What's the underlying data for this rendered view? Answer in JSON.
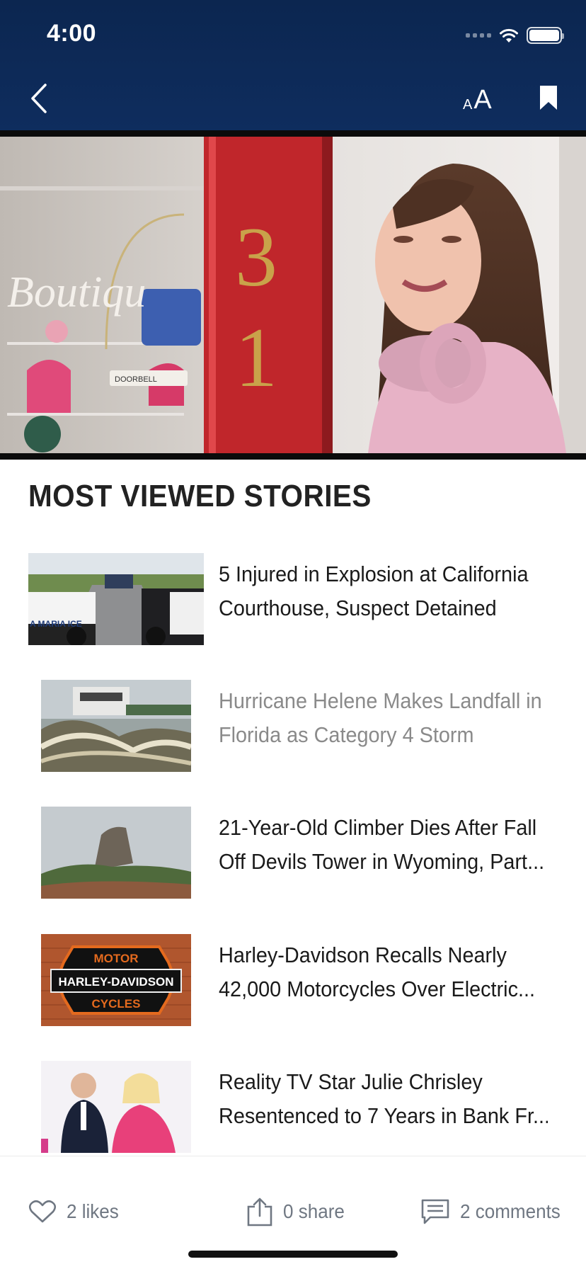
{
  "status_bar": {
    "time": "4:00"
  },
  "header": {
    "font_small": "A",
    "font_big": "A"
  },
  "hero": {
    "sign_text": "Boutiqu",
    "door_numbers": [
      "3",
      "1"
    ],
    "doorbell_label": "DOORBELL"
  },
  "section": {
    "title": "MOST VIEWED STORIES"
  },
  "stories": [
    {
      "line1": "5 Injured in Explosion at California",
      "line2": "Courthouse, Suspect Detained",
      "muted": false,
      "thumb_text": "A MARIA  ICE"
    },
    {
      "line1": "Hurricane Helene Makes Landfall in",
      "line2": "Florida as Category 4 Storm",
      "muted": true,
      "thumb_text": ""
    },
    {
      "line1": "21-Year-Old Climber Dies After Fall",
      "line2": "Off Devils Tower in Wyoming, Part...",
      "muted": false,
      "thumb_text": ""
    },
    {
      "line1": "Harley-Davidson Recalls Nearly",
      "line2": "42,000 Motorcycles Over Electric...",
      "muted": false,
      "thumb_text": [
        "MOTOR",
        "HARLEY-DAVIDSON",
        "CYCLES"
      ]
    },
    {
      "line1": "Reality TV Star Julie Chrisley",
      "line2": "Resentenced to 7 Years in Bank Fr...",
      "muted": false,
      "thumb_text": ""
    }
  ],
  "bottom_bar": {
    "likes": "2 likes",
    "shares": "0 share",
    "comments": "2 comments"
  },
  "colors": {
    "header_bg": "#0e2d5e",
    "muted_text": "#8a8a8a",
    "action_text": "#6f7782"
  }
}
